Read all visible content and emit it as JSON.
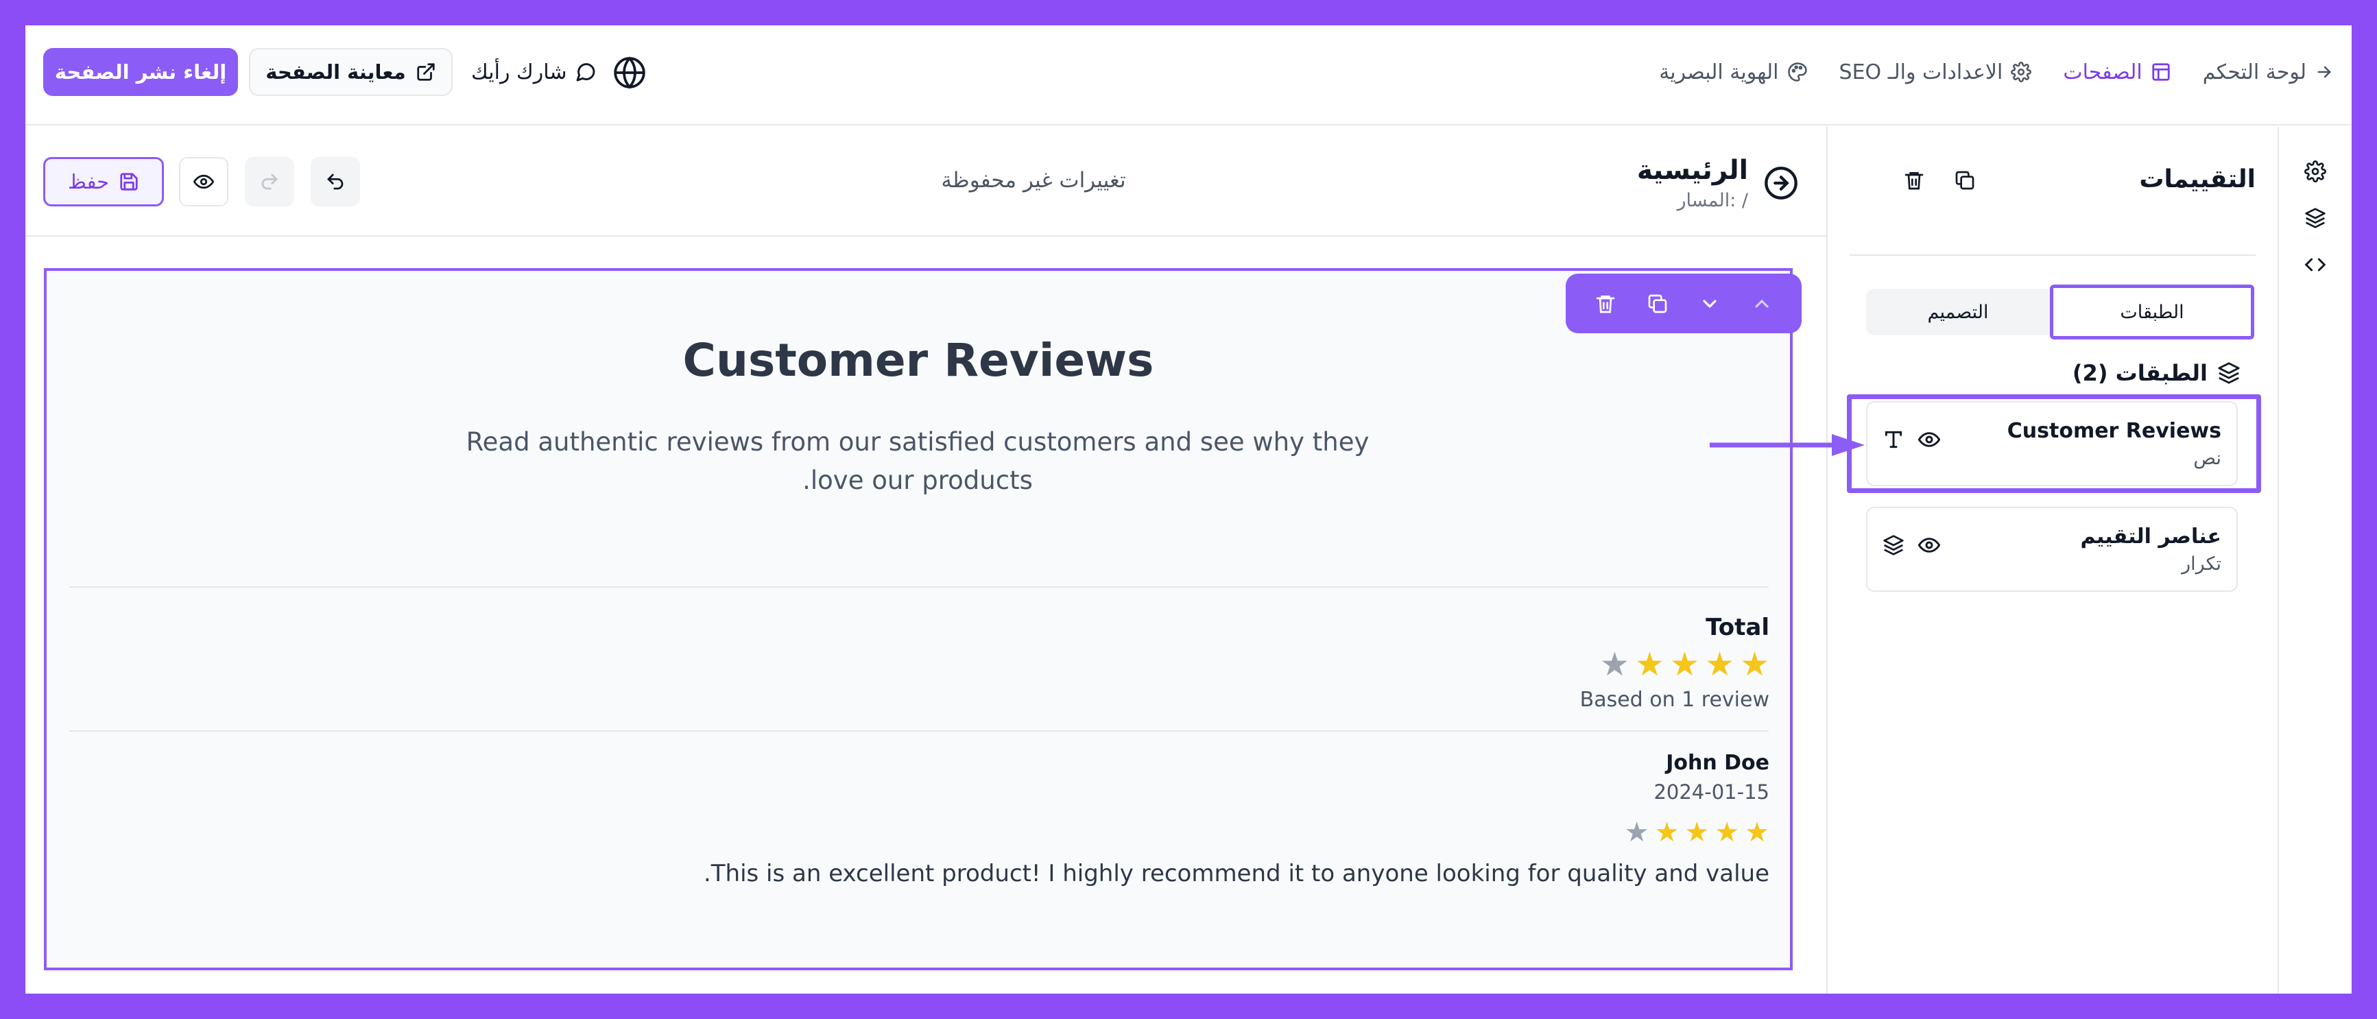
{
  "topbar": {
    "publish_label": "إلغاء نشر الصفحة",
    "preview_label": "معاينة الصفحة",
    "feedback_label": "شارك رأيك",
    "nav": [
      {
        "label": "لوحة التحكم",
        "icon": "arrow-right-icon",
        "active": false
      },
      {
        "label": "الصفحات",
        "icon": "pages-icon",
        "active": true
      },
      {
        "label": "الاعدادات والـ SEO",
        "icon": "gear-icon",
        "active": false
      },
      {
        "label": "الهوية البصرية",
        "icon": "palette-icon",
        "active": false
      }
    ]
  },
  "toolbar": {
    "save_label": "حفظ",
    "unsaved_label": "تغييرات غير محفوظة",
    "page_title": "الرئيسية",
    "page_path": "المسار: /"
  },
  "section": {
    "title": "Customer Reviews",
    "subtitle": "Read authentic reviews from our satisfied customers and see why they love our products.",
    "total_label": "Total",
    "total_rating": 4.5,
    "based_on": "Based on 1 review",
    "review": {
      "author": "John Doe",
      "date": "2024-01-15",
      "rating": 4.5,
      "text": "This is an excellent product! I highly recommend it to anyone looking for quality and value."
    }
  },
  "panel": {
    "title": "التقييمات",
    "tabs": [
      {
        "label": "الطبقات",
        "active": true
      },
      {
        "label": "التصميم",
        "active": false
      }
    ],
    "layers_heading": "الطبقات (2)",
    "layers": [
      {
        "name": "Customer Reviews",
        "type": "نص",
        "icon": "text-icon"
      },
      {
        "name": "عناصر التقييم",
        "type": "تكرار",
        "icon": "layers-icon"
      }
    ]
  },
  "colors": {
    "accent": "#8b5cf6",
    "star": "#f5c518",
    "star_dim": "#9ca3af"
  }
}
